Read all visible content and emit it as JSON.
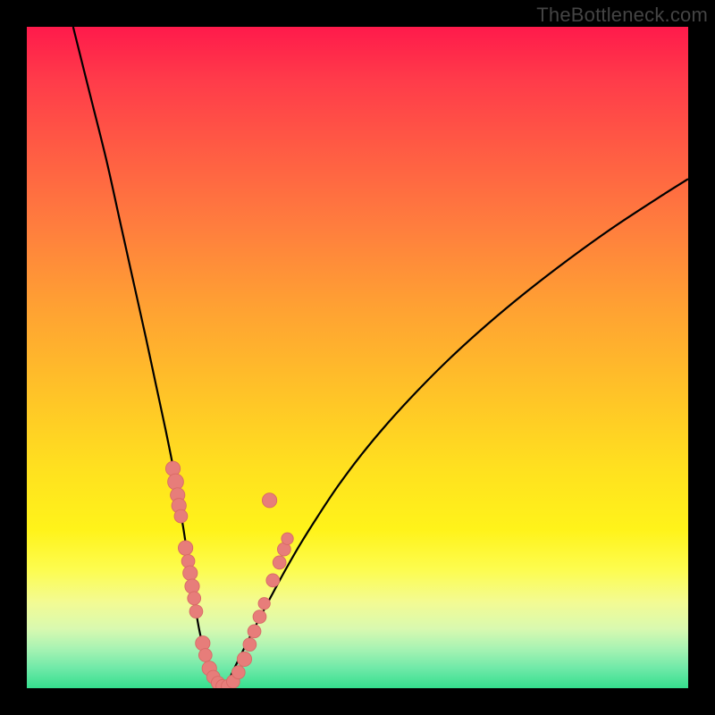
{
  "watermark": "TheBottleneck.com",
  "colors": {
    "bg_black": "#000000",
    "curve_stroke": "#000000",
    "dot_fill": "#e77d7a",
    "dot_stroke": "#d86a66"
  },
  "chart_data": {
    "type": "line",
    "title": "",
    "xlabel": "",
    "ylabel": "",
    "xlim": [
      0,
      100
    ],
    "ylim": [
      0,
      100
    ],
    "note": "V-shaped bottleneck curve; data points (dots) clustered along lower part of the V. x/y in plot-area percent coordinates (0=left/top, 100=right/bottom).",
    "series": [
      {
        "name": "bottleneck-curve-left",
        "kind": "curve",
        "x": [
          7,
          9.5,
          12,
          14,
          16,
          18,
          19.5,
          21,
          22.2,
          23,
          23.7,
          24.3,
          24.8,
          25.2,
          25.6,
          26,
          26.4,
          26.8,
          27.2,
          27.7,
          28.3,
          29.1,
          30
        ],
        "y": [
          0,
          10,
          20,
          29,
          38,
          47,
          54,
          61,
          67,
          72,
          76,
          80,
          83,
          86,
          88.5,
          90.8,
          92.7,
          94.4,
          96,
          97.3,
          98.4,
          99.3,
          100
        ]
      },
      {
        "name": "bottleneck-curve-right",
        "kind": "curve",
        "x": [
          30,
          31,
          32.2,
          33.6,
          35.2,
          37,
          39,
          41.3,
          44,
          47,
          50.5,
          54.5,
          59,
          64,
          69.5,
          75.5,
          82,
          89,
          96.5,
          100
        ],
        "y": [
          100,
          97.8,
          95.3,
          92.5,
          89.4,
          86,
          82.3,
          78.3,
          74,
          69.5,
          64.8,
          60,
          55.1,
          50.1,
          45.1,
          40.1,
          35.1,
          30.1,
          25.2,
          23
        ]
      }
    ],
    "dots": [
      {
        "x": 22.1,
        "y": 66.8,
        "r": 1.1
      },
      {
        "x": 22.5,
        "y": 68.8,
        "r": 1.2
      },
      {
        "x": 22.8,
        "y": 70.8,
        "r": 1.1
      },
      {
        "x": 23.0,
        "y": 72.4,
        "r": 1.1
      },
      {
        "x": 23.3,
        "y": 74.0,
        "r": 1.0
      },
      {
        "x": 24.0,
        "y": 78.8,
        "r": 1.1
      },
      {
        "x": 24.4,
        "y": 80.8,
        "r": 1.0
      },
      {
        "x": 24.7,
        "y": 82.6,
        "r": 1.1
      },
      {
        "x": 25.0,
        "y": 84.6,
        "r": 1.1
      },
      {
        "x": 25.3,
        "y": 86.4,
        "r": 1.0
      },
      {
        "x": 25.6,
        "y": 88.4,
        "r": 1.0
      },
      {
        "x": 26.6,
        "y": 93.2,
        "r": 1.1
      },
      {
        "x": 27.0,
        "y": 95.0,
        "r": 1.0
      },
      {
        "x": 27.6,
        "y": 97.0,
        "r": 1.1
      },
      {
        "x": 28.2,
        "y": 98.3,
        "r": 1.0
      },
      {
        "x": 28.9,
        "y": 99.2,
        "r": 1.0
      },
      {
        "x": 29.6,
        "y": 99.7,
        "r": 1.0
      },
      {
        "x": 30.4,
        "y": 99.7,
        "r": 1.0
      },
      {
        "x": 31.2,
        "y": 99.0,
        "r": 1.0
      },
      {
        "x": 32.0,
        "y": 97.6,
        "r": 1.0
      },
      {
        "x": 32.9,
        "y": 95.6,
        "r": 1.1
      },
      {
        "x": 33.7,
        "y": 93.4,
        "r": 1.0
      },
      {
        "x": 34.4,
        "y": 91.4,
        "r": 1.0
      },
      {
        "x": 35.2,
        "y": 89.2,
        "r": 1.0
      },
      {
        "x": 35.9,
        "y": 87.2,
        "r": 0.9
      },
      {
        "x": 37.2,
        "y": 83.7,
        "r": 1.0
      },
      {
        "x": 38.2,
        "y": 81.0,
        "r": 1.0
      },
      {
        "x": 38.9,
        "y": 79.0,
        "r": 1.0
      },
      {
        "x": 39.4,
        "y": 77.4,
        "r": 0.9
      },
      {
        "x": 36.7,
        "y": 71.6,
        "r": 1.1
      }
    ]
  }
}
